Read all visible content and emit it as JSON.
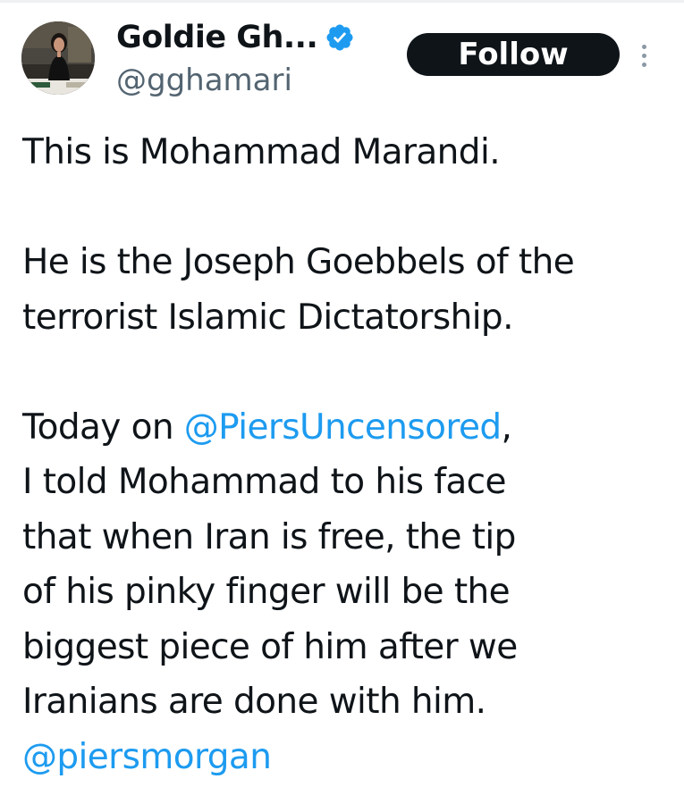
{
  "author": {
    "display_name": "Goldie Gh...",
    "handle": "@gghamari",
    "verified": true,
    "avatar_icon": "avatar-photo"
  },
  "actions": {
    "follow_label": "Follow",
    "more_icon": "more-options-icon"
  },
  "tweet": {
    "line_1": "This is Mohammad Marandi.",
    "line_2": "He is the Joseph Goebbels of the",
    "line_3": "terrorist Islamic Dictatorship.",
    "line_4_prefix": "Today on ",
    "line_4_mention": "@PiersUncensored",
    "line_4_suffix": ",",
    "line_5": "I told Mohammad to his face",
    "line_6": "that when Iran is free, the tip",
    "line_7": "of his pinky finger will be the",
    "line_8": "biggest piece of him after we",
    "line_9": "Iranians are done with him.",
    "line_10_mention": "@piersmorgan"
  },
  "colors": {
    "text": "#0f1419",
    "secondary": "#536471",
    "link": "#1d9bf0",
    "verified": "#1d9bf0",
    "button_bg": "#0f1419",
    "button_text": "#ffffff"
  }
}
